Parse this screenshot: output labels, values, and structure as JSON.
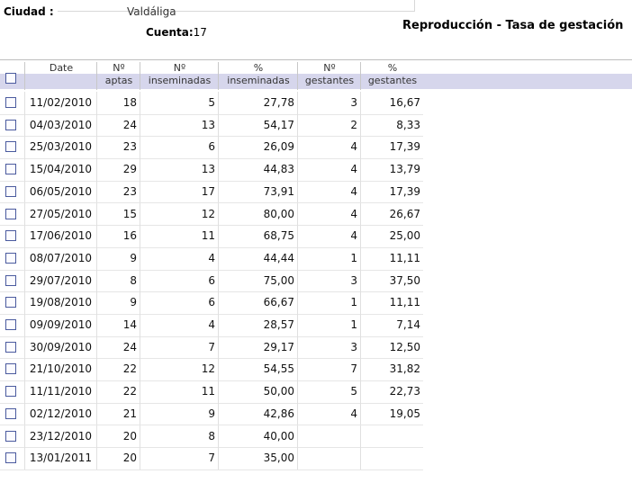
{
  "header": {
    "city_label": "Ciudad :",
    "city_value": "Valdáliga",
    "count_label": "Cuenta:",
    "count_value": "17",
    "report_title": "Reproducción - Tasa de gestación"
  },
  "columns": [
    {
      "line1": "Date",
      "line2": ""
    },
    {
      "line1": "Nº",
      "line2": "aptas"
    },
    {
      "line1": "Nº",
      "line2": "inseminadas"
    },
    {
      "line1": "%",
      "line2": "inseminadas"
    },
    {
      "line1": "Nº",
      "line2": "gestantes"
    },
    {
      "line1": "%",
      "line2": "gestantes"
    }
  ],
  "rows": [
    [
      "11/02/2010",
      "18",
      "5",
      "27,78",
      "3",
      "16,67"
    ],
    [
      "04/03/2010",
      "24",
      "13",
      "54,17",
      "2",
      "8,33"
    ],
    [
      "25/03/2010",
      "23",
      "6",
      "26,09",
      "4",
      "17,39"
    ],
    [
      "15/04/2010",
      "29",
      "13",
      "44,83",
      "4",
      "13,79"
    ],
    [
      "06/05/2010",
      "23",
      "17",
      "73,91",
      "4",
      "17,39"
    ],
    [
      "27/05/2010",
      "15",
      "12",
      "80,00",
      "4",
      "26,67"
    ],
    [
      "17/06/2010",
      "16",
      "11",
      "68,75",
      "4",
      "25,00"
    ],
    [
      "08/07/2010",
      "9",
      "4",
      "44,44",
      "1",
      "11,11"
    ],
    [
      "29/07/2010",
      "8",
      "6",
      "75,00",
      "3",
      "37,50"
    ],
    [
      "19/08/2010",
      "9",
      "6",
      "66,67",
      "1",
      "11,11"
    ],
    [
      "09/09/2010",
      "14",
      "4",
      "28,57",
      "1",
      "7,14"
    ],
    [
      "30/09/2010",
      "24",
      "7",
      "29,17",
      "3",
      "12,50"
    ],
    [
      "21/10/2010",
      "22",
      "12",
      "54,55",
      "7",
      "31,82"
    ],
    [
      "11/11/2010",
      "22",
      "11",
      "50,00",
      "5",
      "22,73"
    ],
    [
      "02/12/2010",
      "21",
      "9",
      "42,86",
      "4",
      "19,05"
    ],
    [
      "23/12/2010",
      "20",
      "8",
      "40,00",
      "",
      ""
    ],
    [
      "13/01/2011",
      "20",
      "7",
      "35,00",
      "",
      ""
    ]
  ]
}
